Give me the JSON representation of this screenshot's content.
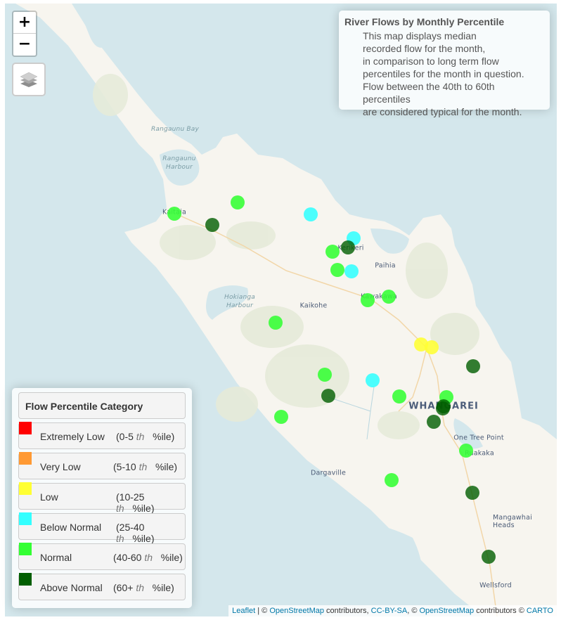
{
  "map": {
    "zoom_in_label": "+",
    "zoom_out_label": "−",
    "layers_icon": "layers-icon",
    "places": [
      {
        "id": "rangaunu-bay",
        "name": "Rangaunu Bay",
        "type": "water"
      },
      {
        "id": "rangaunu-harbour",
        "name": "Rangaunu\nHarbour",
        "type": "water"
      },
      {
        "id": "hokianga-harbour",
        "name": "Hokianga\nHarbour",
        "type": "water"
      },
      {
        "id": "kaitaia",
        "name": "Kaitaia",
        "type": "town"
      },
      {
        "id": "kerikeri",
        "name": "Kerikeri",
        "type": "town"
      },
      {
        "id": "paihia",
        "name": "Paihia",
        "type": "town"
      },
      {
        "id": "kawakawa",
        "name": "Kawakawa",
        "type": "town"
      },
      {
        "id": "kaikohe",
        "name": "Kaikohe",
        "type": "town"
      },
      {
        "id": "whangarei",
        "name": "WHANGAREI",
        "type": "city"
      },
      {
        "id": "one-tree-point",
        "name": "One Tree Point",
        "type": "town"
      },
      {
        "id": "ruakaka",
        "name": "Ruakaka",
        "type": "town"
      },
      {
        "id": "dargaville",
        "name": "Dargaville",
        "type": "town"
      },
      {
        "id": "mangawhai-heads",
        "name": "Mangawhai\nHeads",
        "type": "town"
      },
      {
        "id": "wellsford",
        "name": "Wellsford",
        "type": "town"
      }
    ],
    "stations": [
      {
        "category": "normal"
      },
      {
        "category": "above_normal"
      },
      {
        "category": "normal"
      },
      {
        "category": "below_normal"
      },
      {
        "category": "below_normal"
      },
      {
        "category": "above_normal"
      },
      {
        "category": "normal"
      },
      {
        "category": "normal"
      },
      {
        "category": "below_normal"
      },
      {
        "category": "normal"
      },
      {
        "category": "normal"
      },
      {
        "category": "normal"
      },
      {
        "category": "low"
      },
      {
        "category": "low"
      },
      {
        "category": "above_normal"
      },
      {
        "category": "normal"
      },
      {
        "category": "above_normal"
      },
      {
        "category": "below_normal"
      },
      {
        "category": "normal"
      },
      {
        "category": "normal"
      },
      {
        "category": "above_normal"
      },
      {
        "category": "above_normal"
      },
      {
        "category": "above_normal"
      },
      {
        "category": "normal"
      },
      {
        "category": "normal"
      },
      {
        "category": "normal"
      },
      {
        "category": "above_normal"
      },
      {
        "category": "above_normal"
      }
    ]
  },
  "info": {
    "title": "River Flows by Monthly Percentile",
    "lines": [
      "This map displays median",
      "recorded flow for the month,",
      "in comparison to long term flow",
      "percentiles for the month in question.",
      "Flow between the 40th to 60th percentiles",
      "are considered typical for the month."
    ]
  },
  "legend": {
    "title": "Flow Percentile Category",
    "items": [
      {
        "key": "extremely_low",
        "label": "Extremely Low",
        "range_start": "(0-5 ",
        "th": "th",
        "range_end": "%ile)",
        "color": "#ff0000"
      },
      {
        "key": "very_low",
        "label": "Very Low",
        "range_start": "(5-10 ",
        "th": "th",
        "range_end": "%ile)",
        "color": "#ff9933"
      },
      {
        "key": "low",
        "label": "Low",
        "range_start": "(10-25 ",
        "th": "th",
        "range_end": "%ile)",
        "color": "#ffff33"
      },
      {
        "key": "below_normal",
        "label": "Below Normal",
        "range_start": "(25-40 ",
        "th": "th",
        "range_end": "%ile)",
        "color": "#33ffff"
      },
      {
        "key": "normal",
        "label": "Normal",
        "range_start": "(40-60 ",
        "th": "th",
        "range_end": "%ile)",
        "color": "#33ff33"
      },
      {
        "key": "above_normal",
        "label": "Above Normal",
        "range_start": "(60+ ",
        "th": "th",
        "range_end": "%ile)",
        "color": "#005e00"
      }
    ]
  },
  "attribution": {
    "leaflet": "Leaflet",
    "sep": " | © ",
    "osm1": "OpenStreetMap",
    "contrib1": " contributors, ",
    "ccbysa": "CC-BY-SA",
    "sep2": ", © ",
    "osm2": "OpenStreetMap",
    "contrib2": " contributors © ",
    "carto": "CARTO"
  }
}
